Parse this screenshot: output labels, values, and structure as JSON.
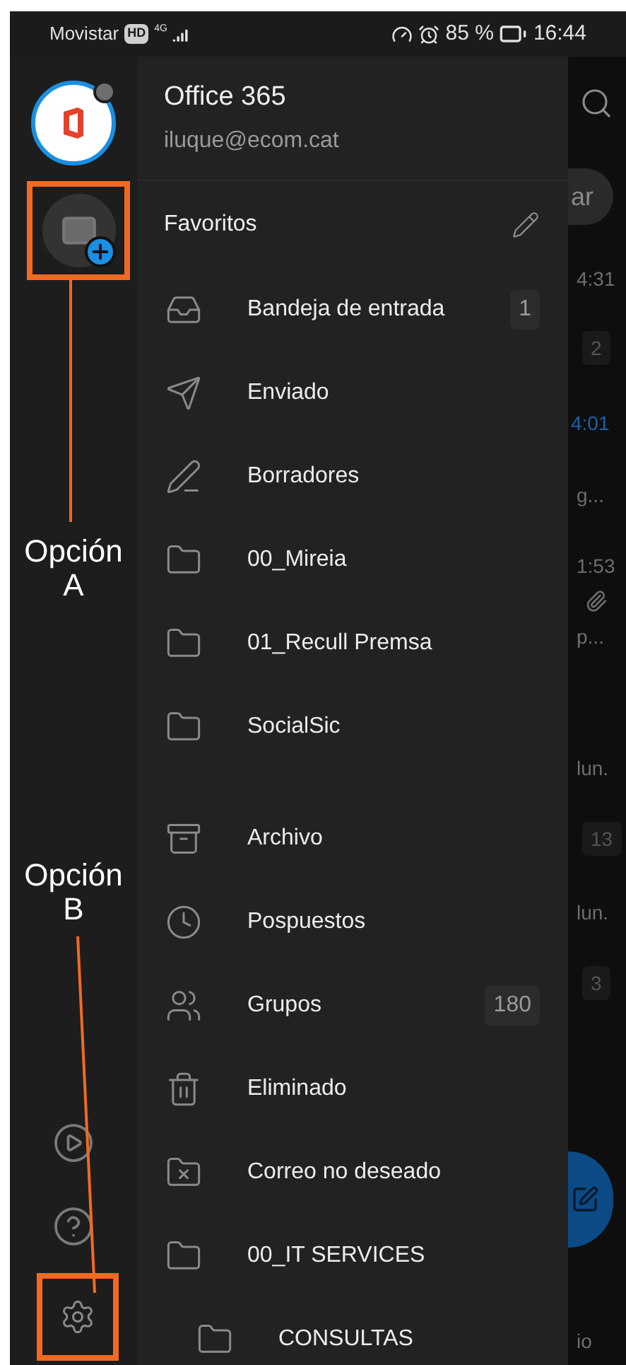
{
  "status_bar": {
    "carrier": "Movistar",
    "hd": "HD",
    "network": "4G",
    "battery": "85 %",
    "time": "16:44"
  },
  "account": {
    "name": "Office 365",
    "email": "iluque@ecom.cat"
  },
  "annotations": [
    {
      "label": "Opción A"
    },
    {
      "label": "Opción B"
    }
  ],
  "favorites": {
    "title": "Favoritos",
    "items": [
      {
        "kind": "inbox",
        "label": "Bandeja de entrada",
        "count": "1"
      },
      {
        "kind": "sent",
        "label": "Enviado"
      },
      {
        "kind": "drafts",
        "label": "Borradores"
      },
      {
        "kind": "folder",
        "label": "00_Mireia"
      },
      {
        "kind": "folder",
        "label": "01_Recull Premsa"
      },
      {
        "kind": "folder",
        "label": "SocialSic"
      }
    ]
  },
  "folders": [
    {
      "kind": "archive",
      "label": "Archivo"
    },
    {
      "kind": "snoozed",
      "label": "Pospuestos"
    },
    {
      "kind": "groups",
      "label": "Grupos",
      "count": "180"
    },
    {
      "kind": "deleted",
      "label": "Eliminado"
    },
    {
      "kind": "junk",
      "label": "Correo no deseado"
    },
    {
      "kind": "folder",
      "label": "00_IT SERVICES",
      "children": [
        {
          "kind": "folder",
          "label": "CONSULTAS"
        }
      ]
    }
  ],
  "background_list": [
    {
      "kind": "pill",
      "text": "ar"
    },
    {
      "kind": "time",
      "text": "4:31"
    },
    {
      "kind": "badge",
      "text": "2"
    },
    {
      "kind": "time_unread",
      "text": "4:01"
    },
    {
      "kind": "text",
      "text": "g..."
    },
    {
      "kind": "time",
      "text": "1:53"
    },
    {
      "kind": "attachment"
    },
    {
      "kind": "text",
      "text": "p..."
    },
    {
      "kind": "time",
      "text": "lun."
    },
    {
      "kind": "badge",
      "text": "13"
    },
    {
      "kind": "time",
      "text": "lun."
    },
    {
      "kind": "badge",
      "text": "3"
    },
    {
      "kind": "fab"
    },
    {
      "kind": "text",
      "text": "io"
    }
  ]
}
